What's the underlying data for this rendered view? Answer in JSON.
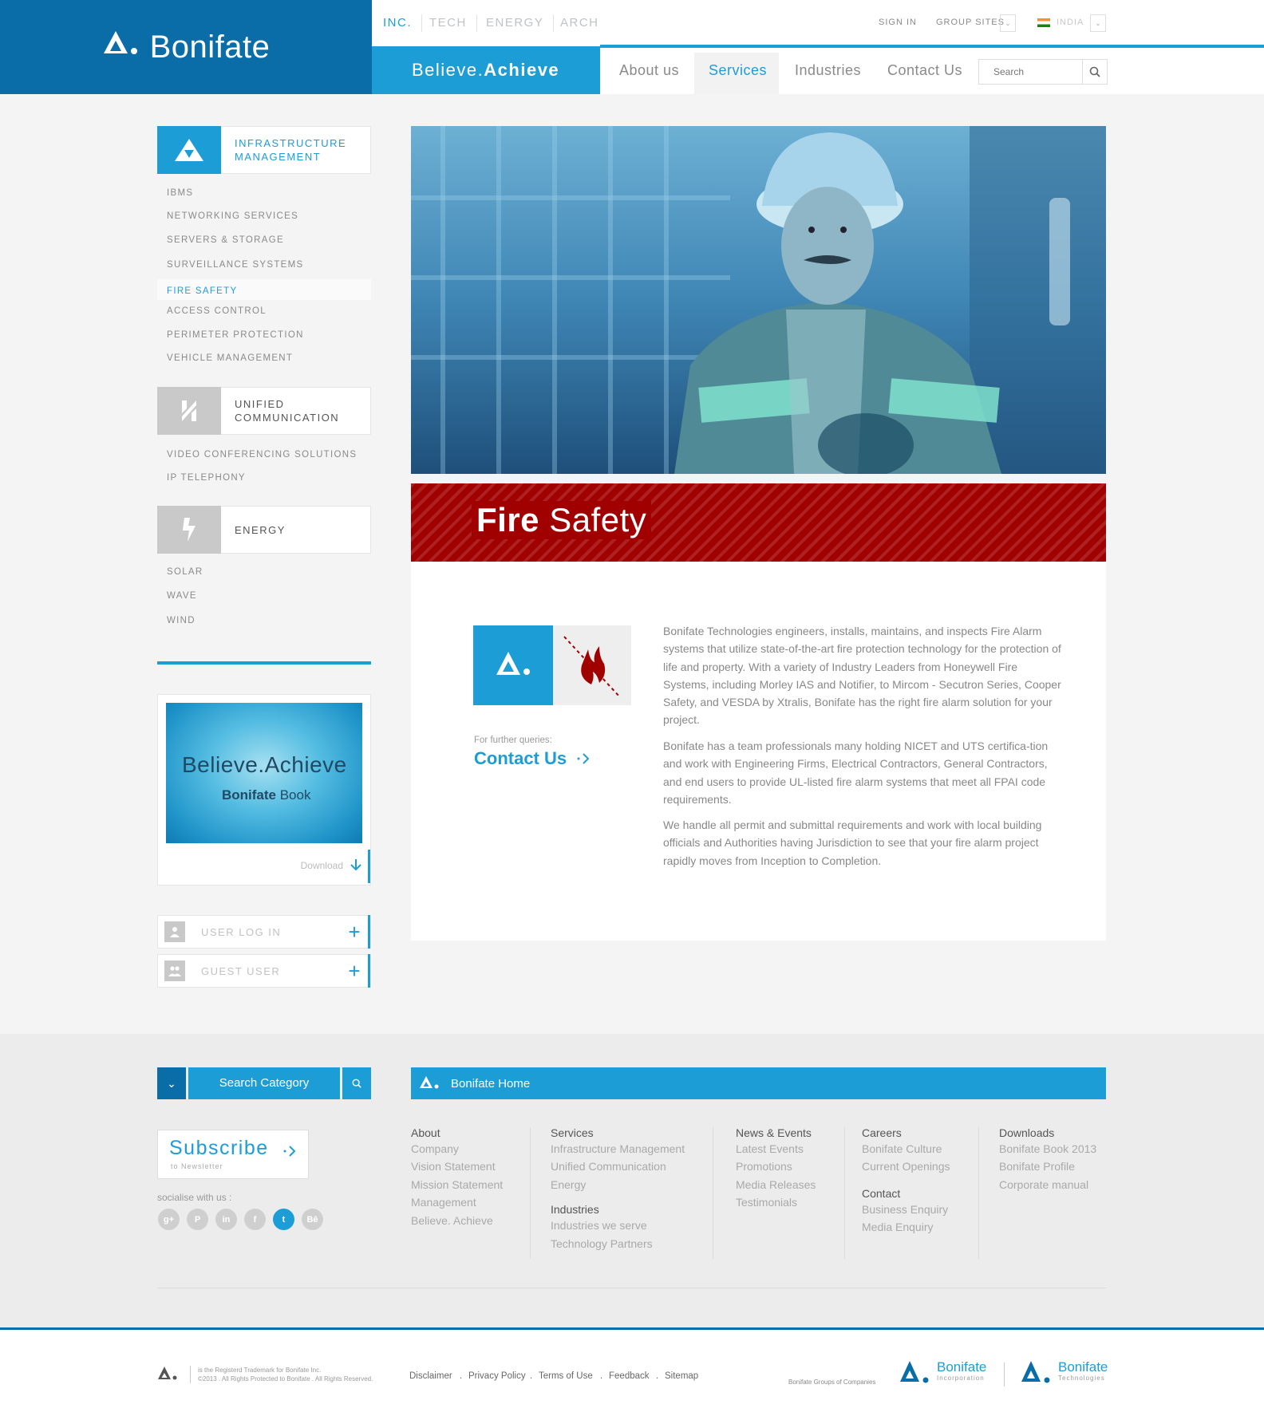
{
  "brand": {
    "name": "Bonifate",
    "tagline_light": "Believe.",
    "tagline_bold": "Achieve"
  },
  "top_tabs": [
    "INC.",
    "TECH",
    "ENERGY",
    "ARCH"
  ],
  "top_links": {
    "sign_in": "SIGN IN",
    "group_sites": "GROUP SITES",
    "country": "INDIA"
  },
  "nav": {
    "items": [
      "About us",
      "Services",
      "Industries",
      "Contact Us"
    ],
    "active": "Services"
  },
  "search": {
    "placeholder": "Search"
  },
  "sidebar": {
    "categories": [
      {
        "label_line1": "INFRASTRUCTURE",
        "label_line2": "MANAGEMENT",
        "icon": "triangle-logo-icon",
        "active": true,
        "items": [
          "IBMS",
          "NETWORKING SERVICES",
          "SERVERS & STORAGE",
          "SURVEILLANCE SYSTEMS",
          "FIRE SAFETY",
          "ACCESS CONTROL",
          "PERIMETER PROTECTION",
          "VEHICLE MANAGEMENT"
        ],
        "active_item": "FIRE SAFETY"
      },
      {
        "label_line1": "UNIFIED",
        "label_line2": "COMMUNICATION",
        "icon": "communication-icon",
        "items": [
          "VIDEO CONFERENCING SOLUTIONS",
          "IP TELEPHONY"
        ]
      },
      {
        "label_line1": "ENERGY",
        "label_line2": "",
        "icon": "lightning-icon",
        "items": [
          "SOLAR",
          "WAVE",
          "WIND"
        ]
      }
    ],
    "book": {
      "line1_a": "Believe.",
      "line1_b": "Achieve",
      "line2_a": "Bonifate",
      "line2_b": " Book",
      "download": "Download"
    },
    "user_login": "USER LOG IN",
    "guest_user": "GUEST USER"
  },
  "page": {
    "title_bold": "Fire",
    "title_light": " Safety",
    "queries_label": "For further queries:",
    "contact_link": "Contact Us",
    "paragraphs": [
      "Bonifate Technologies engineers, installs, maintains, and inspects Fire Alarm systems that utilize state-of-the-art fire protection technology for the protection of life and property. With a variety of Industry Leaders from Honeywell Fire Systems, including Morley IAS and Notifier, to Mircom - Secutron Series, Cooper Safety, and VESDA by Xtralis, Bonifate has the right fire alarm solution for your project.",
      "Bonifate has a team professionals many holding NICET and UTS certifica-tion and work with Engineering Firms, Electrical Contractors, General Contractors, and end users to provide UL-listed fire alarm systems that meet all FPAI code requirements.",
      "We handle all permit and submittal requirements and work with local building officials and Authorities having Jurisdiction to see that your fire alarm project rapidly moves from Inception to Completion."
    ]
  },
  "footer": {
    "search_category": "Search Category",
    "home_label": "Bonifate Home",
    "subscribe": "Subscribe",
    "subscribe_sub": "to Newsletter",
    "socialise": "socialise with us :",
    "social_icons": [
      "google-plus-icon",
      "pinterest-icon",
      "linkedin-icon",
      "facebook-icon",
      "twitter-icon",
      "behance-icon"
    ],
    "social_glyphs": [
      "g+",
      "P",
      "in",
      "f",
      "t",
      "Bē"
    ],
    "columns": {
      "about": {
        "head": "About",
        "links": [
          "Company",
          "Vision Statement",
          "Mission Statement",
          "Management",
          "Believe. Achieve"
        ]
      },
      "services": {
        "head": "Services",
        "links": [
          "Infrastructure Management",
          "Unified Communication",
          "Energy"
        ]
      },
      "industries": {
        "head": "Industries",
        "links": [
          "Industries we serve",
          "Technology Partners"
        ]
      },
      "news": {
        "head": "News & Events",
        "links": [
          "Latest Events",
          "Promotions",
          "Media Releases",
          "Testimonials"
        ]
      },
      "careers": {
        "head": "Careers",
        "links": [
          "Bonifate Culture",
          "Current Openings"
        ]
      },
      "contact": {
        "head": "Contact",
        "links": [
          "Business Enquiry",
          "Media Enquiry"
        ]
      },
      "downloads": {
        "head": "Downloads",
        "links": [
          "Bonifate Book 2013",
          "Bonifate Profile",
          "Corporate manual"
        ]
      }
    },
    "legal_line1": "is the Registerd Trademark for Bonifate Inc.",
    "legal_line2": "©2013 . All Rights Protected to Bonifate . All Rights Reserved.",
    "bottom_links": [
      "Disclaimer",
      "Privacy Policy",
      "Terms of Use",
      "Feedback",
      "Sitemap"
    ],
    "group_label": "Bonifate Groups of Companies",
    "group_logos": [
      {
        "name": "Bonifate",
        "sub": "Incorporation"
      },
      {
        "name": "Bonifate",
        "sub": "Technologies"
      }
    ]
  },
  "colors": {
    "primary": "#1d9dd6",
    "dark_primary": "#0b6da8",
    "fire_red": "#a10000"
  }
}
